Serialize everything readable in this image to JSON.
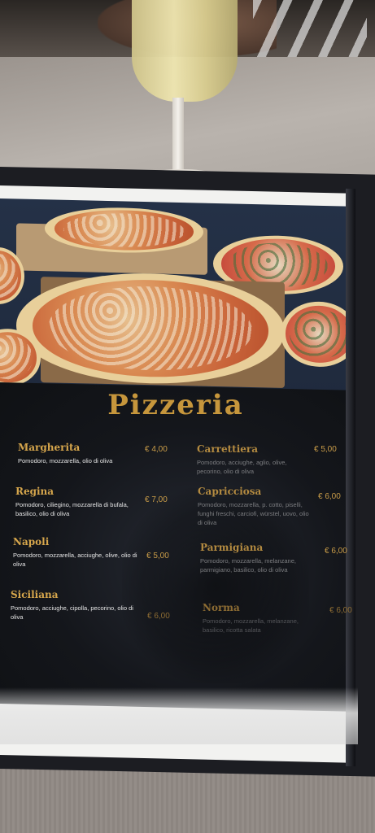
{
  "menu": {
    "title": "Pizzeria",
    "left_items": [
      {
        "name": "Margherita",
        "desc": "Pomodoro, mozzarella, olio di oliva",
        "price": "€ 4,00"
      },
      {
        "name": "Regina",
        "desc": "Pomodoro, ciliegino, mozzarella di bufala, basilico, olio di oliva",
        "price": "€ 7,00"
      },
      {
        "name": "Napoli",
        "desc": "Pomodoro, mozzarella, acciughe, olive, olio di oliva",
        "price": "€ 5,00"
      },
      {
        "name": "Siciliana",
        "desc": "Pomodoro, acciughe, cipolla, pecorino, olio di oliva",
        "price": "€ 6,00"
      }
    ],
    "right_items": [
      {
        "name": "Carrettiera",
        "desc": "Pomodoro, acciughe, aglio, olive, pecorino, olio di oliva",
        "price": "€ 5,00"
      },
      {
        "name": "Capricciosa",
        "desc": "Pomodoro, mozzarella, p. cotto, piselli, funghi freschi, carciofi, würstel, uovo, olio di oliva",
        "price": "€ 6,00"
      },
      {
        "name": "Parmigiana",
        "desc": "Pomodoro, mozzarella, melanzane, parmigiano, basilico, olio di oliva",
        "price": "€ 6,00"
      },
      {
        "name": "Norma",
        "desc": "Pomodoro, mozzarella, melanzane, basilico, ricotta salata",
        "price": "€ 6,00"
      }
    ]
  },
  "colors": {
    "title_gold": "#c6963c",
    "panel_dark": "#14161b",
    "photo_background": "#243147"
  }
}
